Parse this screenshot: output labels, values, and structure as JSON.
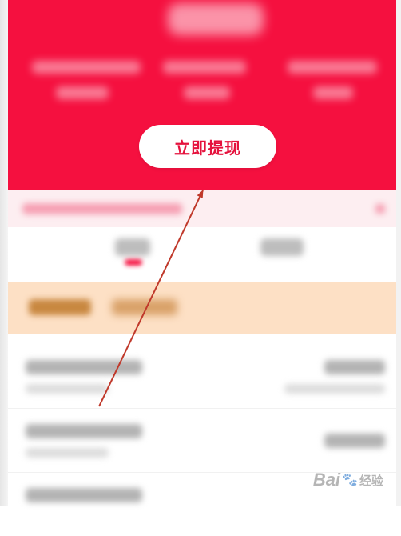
{
  "hero": {
    "withdraw_button_label": "立即提现"
  },
  "watermark": {
    "brand_prefix": "Bai",
    "brand_suffix": "经验"
  },
  "colors": {
    "accent": "#f5103f",
    "annotation_arrow": "#c0392b"
  }
}
